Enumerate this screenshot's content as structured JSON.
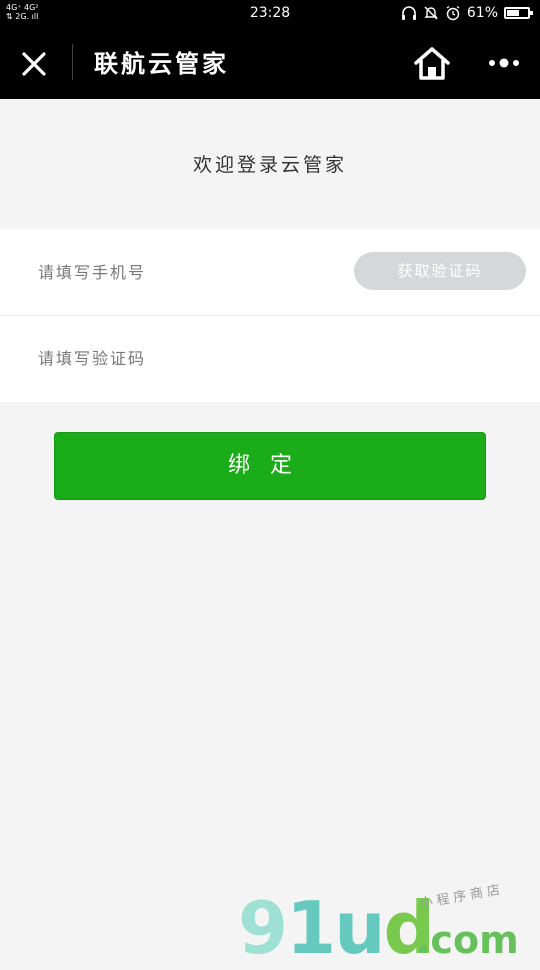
{
  "status_bar": {
    "signal_text": "4G⁺ 4G²\n2G",
    "time": "23:28",
    "battery_text": "61%",
    "battery_level": 0.61
  },
  "navbar": {
    "title": "联航云管家",
    "close_icon": "close-icon",
    "home_icon": "home-icon",
    "more_icon": "more-icon"
  },
  "welcome": "欢迎登录云管家",
  "form": {
    "phone_placeholder": "请填写手机号",
    "get_code_label": "获取验证码",
    "code_placeholder": "请填写验证码"
  },
  "bind_label": "绑定",
  "watermark": {
    "brand": "91ud",
    "domain": ".com",
    "tagline": "小程序商店"
  },
  "colors": {
    "primary": "#1aad19",
    "navbar": "#000000",
    "background": "#f4f4f4",
    "disabled_button": "#d5d7d9"
  }
}
